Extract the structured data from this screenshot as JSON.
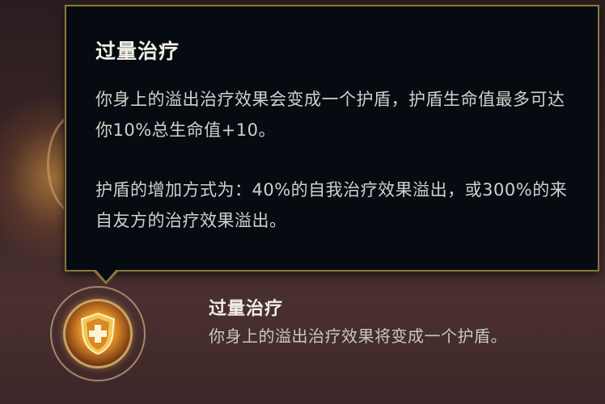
{
  "tooltip": {
    "title": "过量治疗",
    "paragraph1": "你身上的溢出治疗效果会变成一个护盾，护盾生命值最多可达你10%总生命值+10。",
    "paragraph2": "护盾的增加方式为：40%的自我治疗效果溢出，或300%的来自友方的治疗效果溢出。"
  },
  "item": {
    "icon": "shield-cross-icon",
    "title": "过量治疗",
    "description": "你身上的溢出治疗效果将变成一个护盾。"
  },
  "colors": {
    "tooltip_bg": "#050b10",
    "tooltip_border": "#8b7442",
    "icon_gold": "#e6952b"
  }
}
